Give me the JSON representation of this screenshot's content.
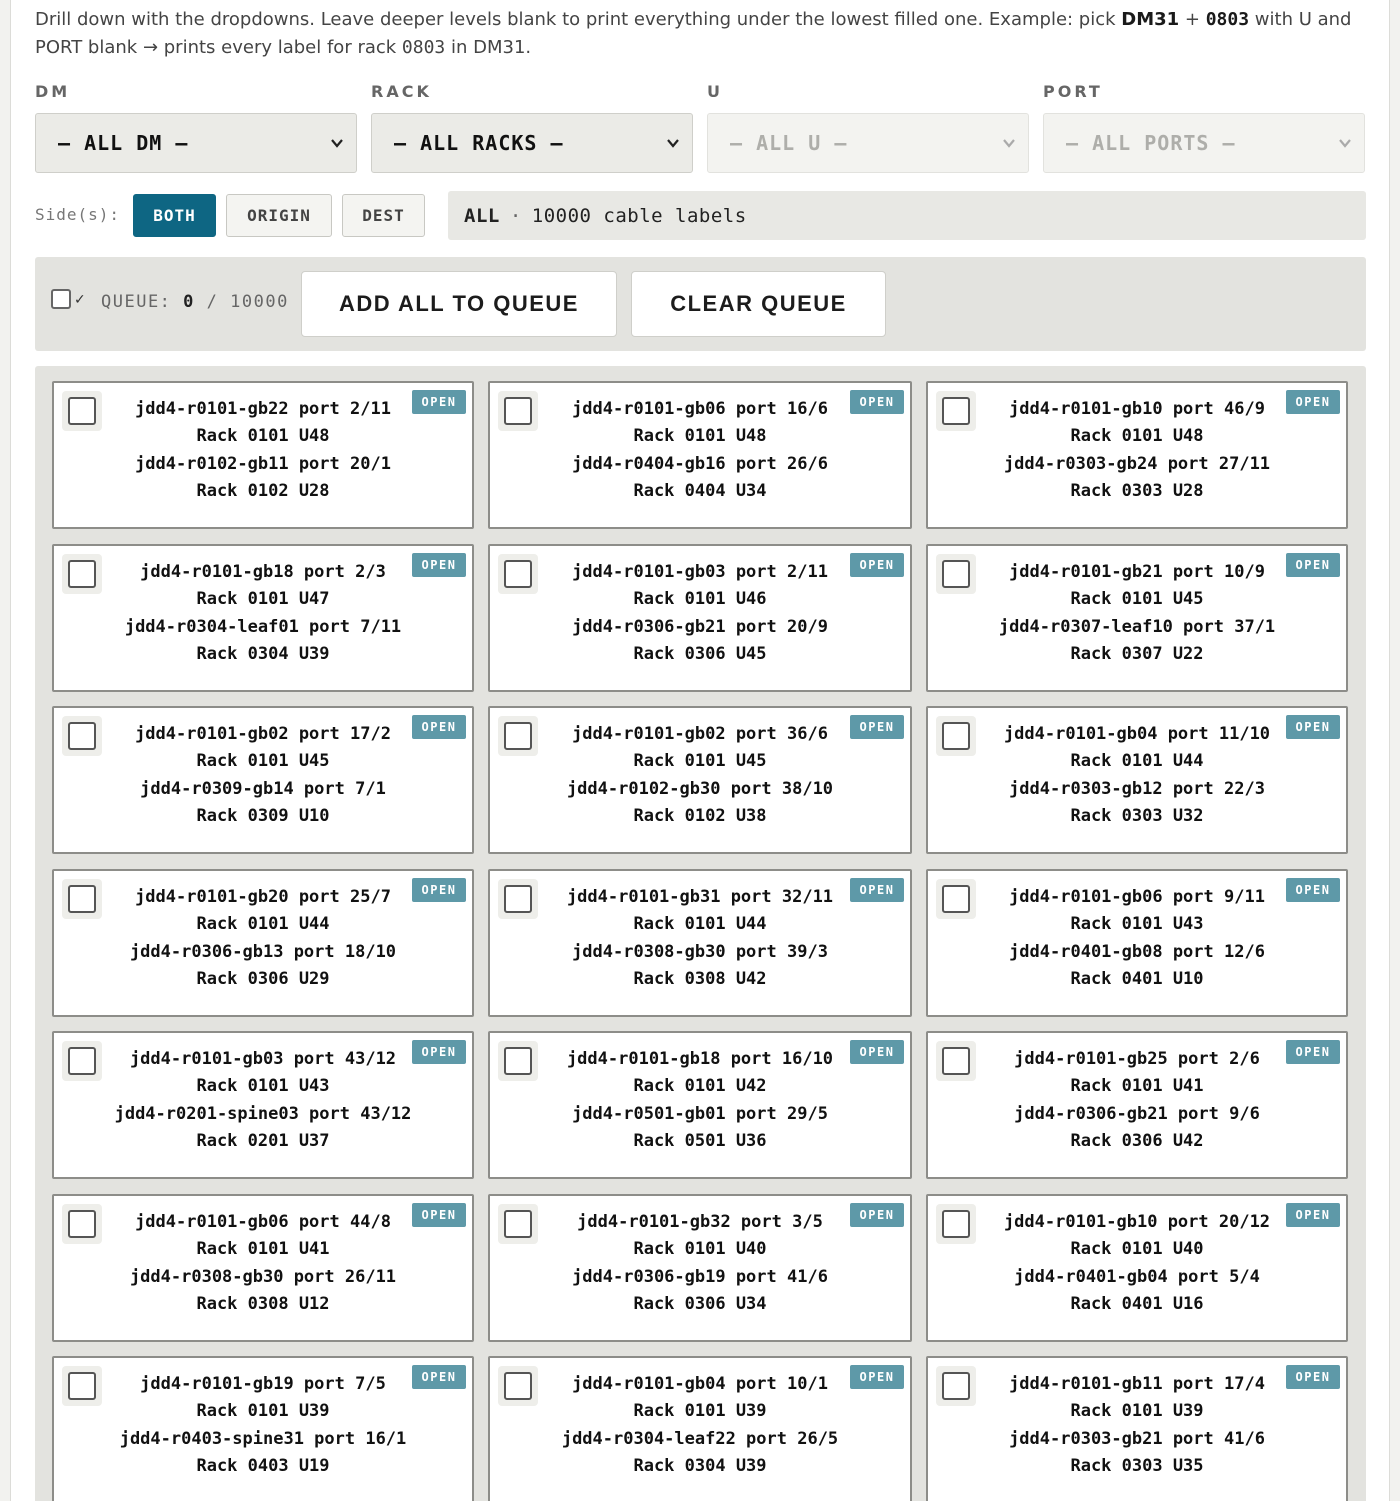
{
  "intro": {
    "part1": "Drill down with the dropdowns. Leave deeper levels blank to print everything under the lowest filled one. Example: pick ",
    "dm_example": "DM31",
    "plus": " + ",
    "rack_example": "0803",
    "part2": " with U and PORT blank → prints every label for rack ",
    "rack_mono": "0803",
    "part3": " in DM31."
  },
  "filters": [
    {
      "label": "DM",
      "value": "— ALL DM —",
      "disabled": false
    },
    {
      "label": "RACK",
      "value": "— ALL RACKS —",
      "disabled": false
    },
    {
      "label": "U",
      "value": "— ALL U —",
      "disabled": true
    },
    {
      "label": "PORT",
      "value": "— ALL PORTS —",
      "disabled": true
    }
  ],
  "sides": {
    "label": "Side(s):",
    "options": [
      "BOTH",
      "ORIGIN",
      "DEST"
    ],
    "active": "BOTH"
  },
  "summary": {
    "scope": "ALL",
    "separator": "·",
    "count_text": "10000 cable labels"
  },
  "queue": {
    "label": "QUEUE:",
    "count": "0",
    "slash": "/",
    "total": "10000",
    "add_all_label": "ADD ALL TO QUEUE",
    "clear_label": "CLEAR QUEUE"
  },
  "colors": {
    "accent": "#0e6683",
    "badge": "#5e99a8"
  },
  "cards": [
    {
      "status": "OPEN",
      "origin": "jdd4-r0101-gb22 port 2/11",
      "origin_loc": "Rack 0101 U48",
      "dest": "jdd4-r0102-gb11 port 20/1",
      "dest_loc": "Rack 0102 U28"
    },
    {
      "status": "OPEN",
      "origin": "jdd4-r0101-gb06 port 16/6",
      "origin_loc": "Rack 0101 U48",
      "dest": "jdd4-r0404-gb16 port 26/6",
      "dest_loc": "Rack 0404 U34"
    },
    {
      "status": "OPEN",
      "origin": "jdd4-r0101-gb10 port 46/9",
      "origin_loc": "Rack 0101 U48",
      "dest": "jdd4-r0303-gb24 port 27/11",
      "dest_loc": "Rack 0303 U28"
    },
    {
      "status": "OPEN",
      "origin": "jdd4-r0101-gb18 port 2/3",
      "origin_loc": "Rack 0101 U47",
      "dest": "jdd4-r0304-leaf01 port 7/11",
      "dest_loc": "Rack 0304 U39"
    },
    {
      "status": "OPEN",
      "origin": "jdd4-r0101-gb03 port 2/11",
      "origin_loc": "Rack 0101 U46",
      "dest": "jdd4-r0306-gb21 port 20/9",
      "dest_loc": "Rack 0306 U45"
    },
    {
      "status": "OPEN",
      "origin": "jdd4-r0101-gb21 port 10/9",
      "origin_loc": "Rack 0101 U45",
      "dest": "jdd4-r0307-leaf10 port 37/1",
      "dest_loc": "Rack 0307 U22"
    },
    {
      "status": "OPEN",
      "origin": "jdd4-r0101-gb02 port 17/2",
      "origin_loc": "Rack 0101 U45",
      "dest": "jdd4-r0309-gb14 port 7/1",
      "dest_loc": "Rack 0309 U10"
    },
    {
      "status": "OPEN",
      "origin": "jdd4-r0101-gb02 port 36/6",
      "origin_loc": "Rack 0101 U45",
      "dest": "jdd4-r0102-gb30 port 38/10",
      "dest_loc": "Rack 0102 U38"
    },
    {
      "status": "OPEN",
      "origin": "jdd4-r0101-gb04 port 11/10",
      "origin_loc": "Rack 0101 U44",
      "dest": "jdd4-r0303-gb12 port 22/3",
      "dest_loc": "Rack 0303 U32"
    },
    {
      "status": "OPEN",
      "origin": "jdd4-r0101-gb20 port 25/7",
      "origin_loc": "Rack 0101 U44",
      "dest": "jdd4-r0306-gb13 port 18/10",
      "dest_loc": "Rack 0306 U29"
    },
    {
      "status": "OPEN",
      "origin": "jdd4-r0101-gb31 port 32/11",
      "origin_loc": "Rack 0101 U44",
      "dest": "jdd4-r0308-gb30 port 39/3",
      "dest_loc": "Rack 0308 U42"
    },
    {
      "status": "OPEN",
      "origin": "jdd4-r0101-gb06 port 9/11",
      "origin_loc": "Rack 0101 U43",
      "dest": "jdd4-r0401-gb08 port 12/6",
      "dest_loc": "Rack 0401 U10"
    },
    {
      "status": "OPEN",
      "origin": "jdd4-r0101-gb03 port 43/12",
      "origin_loc": "Rack 0101 U43",
      "dest": "jdd4-r0201-spine03 port 43/12",
      "dest_loc": "Rack 0201 U37"
    },
    {
      "status": "OPEN",
      "origin": "jdd4-r0101-gb18 port 16/10",
      "origin_loc": "Rack 0101 U42",
      "dest": "jdd4-r0501-gb01 port 29/5",
      "dest_loc": "Rack 0501 U36"
    },
    {
      "status": "OPEN",
      "origin": "jdd4-r0101-gb25 port 2/6",
      "origin_loc": "Rack 0101 U41",
      "dest": "jdd4-r0306-gb21 port 9/6",
      "dest_loc": "Rack 0306 U42"
    },
    {
      "status": "OPEN",
      "origin": "jdd4-r0101-gb06 port 44/8",
      "origin_loc": "Rack 0101 U41",
      "dest": "jdd4-r0308-gb30 port 26/11",
      "dest_loc": "Rack 0308 U12"
    },
    {
      "status": "OPEN",
      "origin": "jdd4-r0101-gb32 port 3/5",
      "origin_loc": "Rack 0101 U40",
      "dest": "jdd4-r0306-gb19 port 41/6",
      "dest_loc": "Rack 0306 U34"
    },
    {
      "status": "OPEN",
      "origin": "jdd4-r0101-gb10 port 20/12",
      "origin_loc": "Rack 0101 U40",
      "dest": "jdd4-r0401-gb04 port 5/4",
      "dest_loc": "Rack 0401 U16"
    },
    {
      "status": "OPEN",
      "origin": "jdd4-r0101-gb19 port 7/5",
      "origin_loc": "Rack 0101 U39",
      "dest": "jdd4-r0403-spine31 port 16/1",
      "dest_loc": "Rack 0403 U19"
    },
    {
      "status": "OPEN",
      "origin": "jdd4-r0101-gb04 port 10/1",
      "origin_loc": "Rack 0101 U39",
      "dest": "jdd4-r0304-leaf22 port 26/5",
      "dest_loc": "Rack 0304 U39"
    },
    {
      "status": "OPEN",
      "origin": "jdd4-r0101-gb11 port 17/4",
      "origin_loc": "Rack 0101 U39",
      "dest": "jdd4-r0303-gb21 port 41/6",
      "dest_loc": "Rack 0303 U35"
    }
  ]
}
